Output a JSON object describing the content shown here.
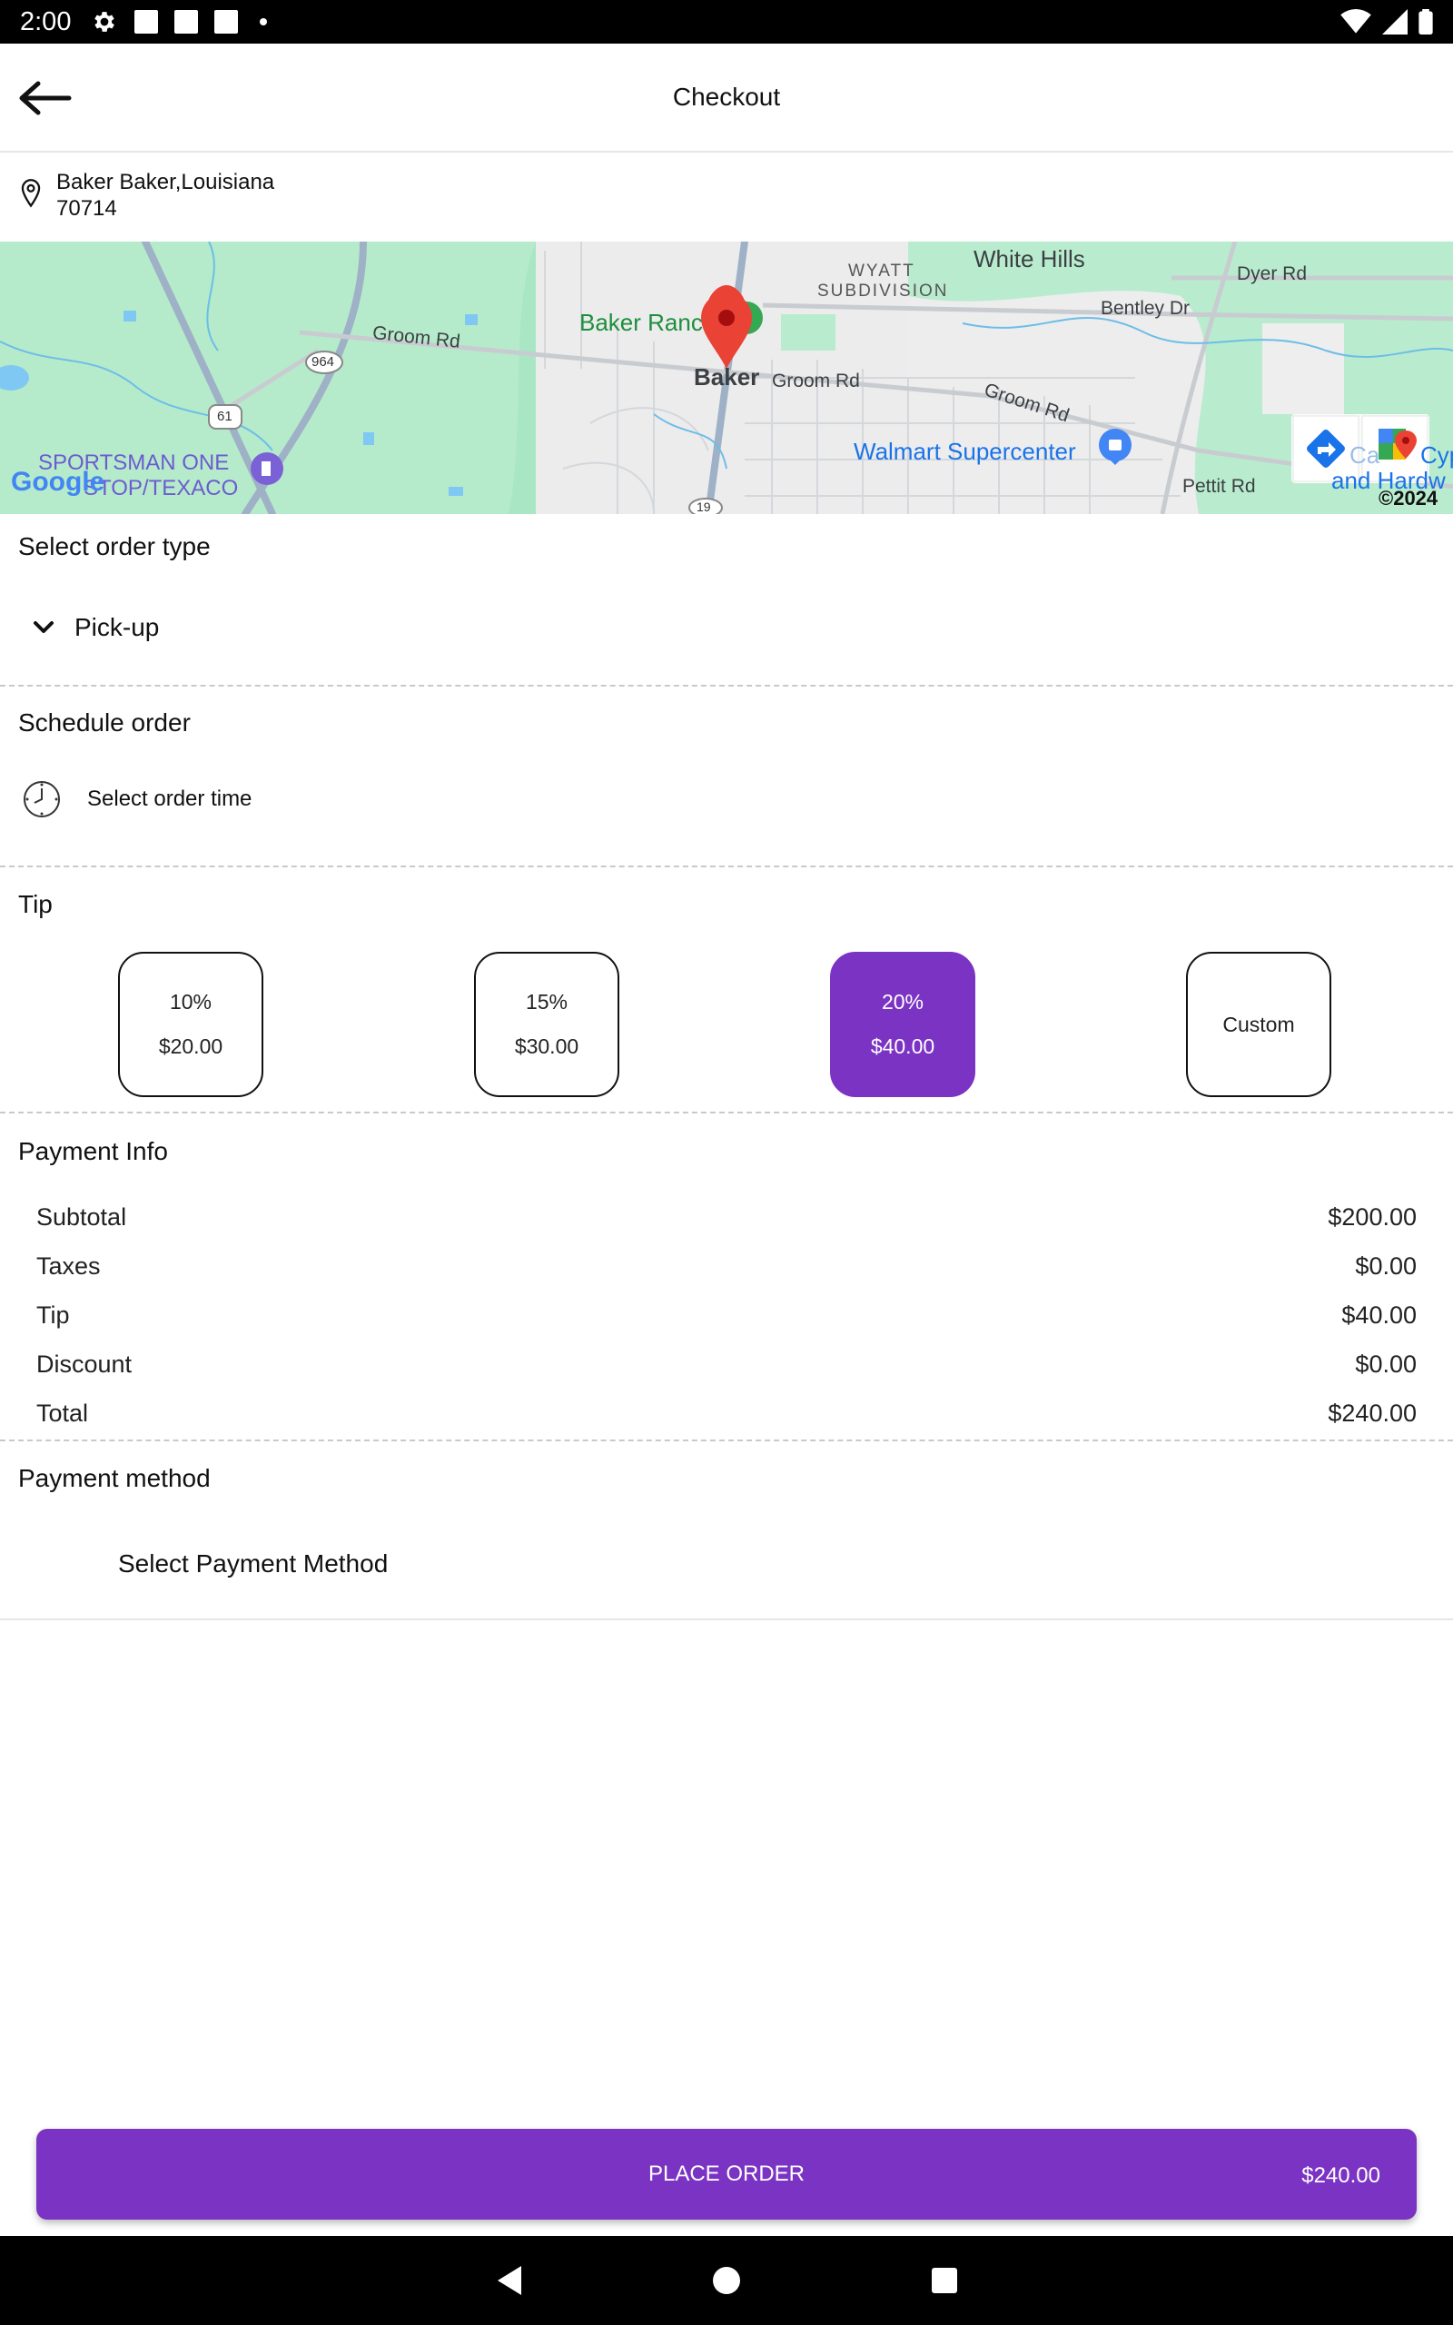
{
  "status_bar": {
    "time": "2:00"
  },
  "app_bar": {
    "title": "Checkout"
  },
  "address": {
    "line1": "Baker  Baker,Louisiana",
    "line2": "70714"
  },
  "map": {
    "labels": {
      "white_hills": "White Hills",
      "wyatt": "WYATT",
      "subdivision": "SUBDIVISION",
      "dyer_rd": "Dyer Rd",
      "bentley_dr": "Bentley Dr",
      "groom_rd_left": "Groom Rd",
      "groom_rd_center": "Groom Rd",
      "groom_rd_right": "Groom Rd",
      "baker_ranch": "Baker Ranc",
      "baker": "Baker",
      "walmart": "Walmart Supercenter",
      "sportsman1": "SPORTSMAN ONE",
      "sportsman2": "STOP/TEXACO",
      "pettit_rd": "Pettit Rd",
      "cane": "Ca",
      "cane_cyp": "Cyp",
      "and_hardw": "and Hardw",
      "google": "Google",
      "copyright": "©2024",
      "route_964": "964",
      "route_61": "61",
      "route_19": "19"
    }
  },
  "order_type": {
    "title": "Select order type",
    "selected": "Pick-up"
  },
  "schedule": {
    "title": "Schedule order",
    "placeholder": "Select order time"
  },
  "tip": {
    "title": "Tip",
    "options": [
      {
        "percent": "10%",
        "amount": "$20.00"
      },
      {
        "percent": "15%",
        "amount": "$30.00"
      },
      {
        "percent": "20%",
        "amount": "$40.00"
      },
      {
        "label": "Custom"
      }
    ],
    "accent_color": "#7b33c4"
  },
  "payment_info": {
    "title": "Payment Info",
    "rows": [
      {
        "label": "Subtotal",
        "value": "$200.00"
      },
      {
        "label": "Taxes",
        "value": "$0.00"
      },
      {
        "label": "Tip",
        "value": "$40.00"
      },
      {
        "label": "Discount",
        "value": "$0.00"
      },
      {
        "label": "Total",
        "value": "$240.00"
      }
    ]
  },
  "payment_method": {
    "title": "Payment method",
    "placeholder": "Select Payment Method"
  },
  "place_order": {
    "label": "PLACE ORDER",
    "total": "$240.00"
  }
}
